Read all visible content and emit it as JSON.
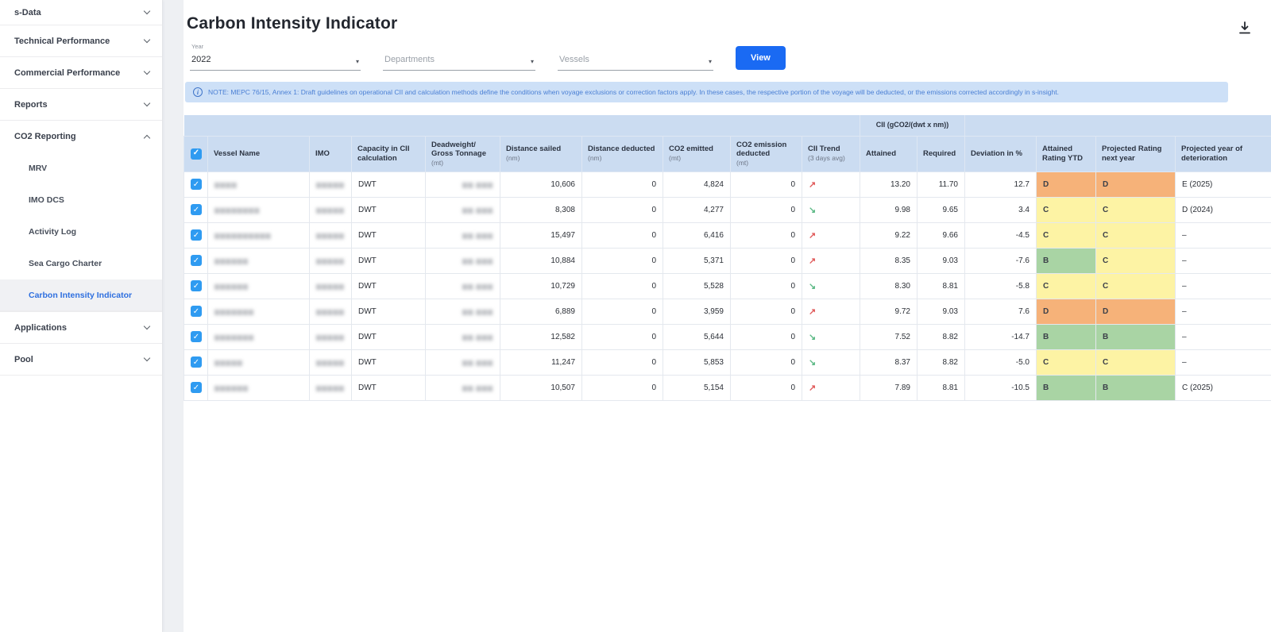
{
  "sidebar": {
    "items": [
      {
        "label": "s-Data",
        "state": "collapsed"
      },
      {
        "label": "Technical Performance",
        "state": "collapsed"
      },
      {
        "label": "Commercial Performance",
        "state": "collapsed"
      },
      {
        "label": "Reports",
        "state": "collapsed"
      },
      {
        "label": "CO2 Reporting",
        "state": "expanded"
      },
      {
        "label": "Applications",
        "state": "collapsed"
      },
      {
        "label": "Pool",
        "state": "collapsed"
      }
    ],
    "co2_children": [
      {
        "label": "MRV",
        "active": false
      },
      {
        "label": "IMO DCS",
        "active": false
      },
      {
        "label": "Activity Log",
        "active": false
      },
      {
        "label": "Sea Cargo Charter",
        "active": false
      },
      {
        "label": "Carbon Intensity Indicator",
        "active": true
      }
    ]
  },
  "header": {
    "title": "Carbon Intensity Indicator"
  },
  "filters": {
    "year_label": "Year",
    "year_value": "2022",
    "departments_placeholder": "Departments",
    "vessels_placeholder": "Vessels",
    "view_button": "View"
  },
  "note": "NOTE: MEPC 76/15, Annex 1: Draft guidelines on operational CII and calculation methods define the conditions when voyage exclusions or correction factors apply. In these cases, the respective portion of the voyage will be deducted, or the emissions corrected accordingly in s-insight.",
  "table": {
    "group_header": "CII (gCO2/(dwt x nm))",
    "columns": {
      "vessel": {
        "label": "Vessel Name",
        "unit": ""
      },
      "imo": {
        "label": "IMO",
        "unit": ""
      },
      "capacity": {
        "label": "Capacity in CII calculation",
        "unit": ""
      },
      "deadweight": {
        "label": "Deadweight/ Gross Tonnage",
        "unit": "(mt)"
      },
      "distance_sailed": {
        "label": "Distance sailed",
        "unit": "(nm)"
      },
      "distance_deducted": {
        "label": "Distance deducted",
        "unit": "(nm)"
      },
      "co2_emitted": {
        "label": "CO2 emitted",
        "unit": "(mt)"
      },
      "co2_deducted": {
        "label": "CO2 emission deducted",
        "unit": "(mt)"
      },
      "trend": {
        "label": "CII Trend",
        "unit": "(3 days avg)"
      },
      "attained": {
        "label": "Attained",
        "unit": ""
      },
      "required": {
        "label": "Required",
        "unit": ""
      },
      "deviation": {
        "label": "Deviation in %",
        "unit": ""
      },
      "attained_rating": {
        "label": "Attained Rating YTD",
        "unit": ""
      },
      "projected_rating": {
        "label": "Projected Rating next year",
        "unit": ""
      },
      "projected_year": {
        "label": "Projected year of deterioration",
        "unit": ""
      }
    },
    "rating_colors": {
      "B": "#a9d4a4",
      "C": "#fdf3a4",
      "D": "#f6b279"
    },
    "trend_glyphs": {
      "up": "↗",
      "down": "↘"
    },
    "trend_colors": {
      "up": "#e05b5b",
      "down": "#5cb985"
    },
    "rows": [
      {
        "vessel": "▆▆▆▆",
        "imo": "▆▆▆▆▆",
        "capacity": "DWT",
        "deadweight": "▆▆,▆▆▆",
        "distance_sailed": "10,606",
        "distance_deducted": "0",
        "co2_emitted": "4,824",
        "co2_deducted": "0",
        "trend": "up",
        "attained": "13.20",
        "required": "11.70",
        "deviation": "12.7",
        "attained_rating": "D",
        "projected_rating": "D",
        "projected_year": "E (2025)"
      },
      {
        "vessel": "▆▆▆▆▆▆▆▆",
        "imo": "▆▆▆▆▆",
        "capacity": "DWT",
        "deadweight": "▆▆,▆▆▆",
        "distance_sailed": "8,308",
        "distance_deducted": "0",
        "co2_emitted": "4,277",
        "co2_deducted": "0",
        "trend": "down",
        "attained": "9.98",
        "required": "9.65",
        "deviation": "3.4",
        "attained_rating": "C",
        "projected_rating": "C",
        "projected_year": "D (2024)"
      },
      {
        "vessel": "▆▆▆▆▆▆▆▆▆▆",
        "imo": "▆▆▆▆▆",
        "capacity": "DWT",
        "deadweight": "▆▆,▆▆▆",
        "distance_sailed": "15,497",
        "distance_deducted": "0",
        "co2_emitted": "6,416",
        "co2_deducted": "0",
        "trend": "up",
        "attained": "9.22",
        "required": "9.66",
        "deviation": "-4.5",
        "attained_rating": "C",
        "projected_rating": "C",
        "projected_year": "–"
      },
      {
        "vessel": "▆▆▆▆▆▆",
        "imo": "▆▆▆▆▆",
        "capacity": "DWT",
        "deadweight": "▆▆,▆▆▆",
        "distance_sailed": "10,884",
        "distance_deducted": "0",
        "co2_emitted": "5,371",
        "co2_deducted": "0",
        "trend": "up",
        "attained": "8.35",
        "required": "9.03",
        "deviation": "-7.6",
        "attained_rating": "B",
        "projected_rating": "C",
        "projected_year": "–"
      },
      {
        "vessel": "▆▆▆▆▆▆",
        "imo": "▆▆▆▆▆",
        "capacity": "DWT",
        "deadweight": "▆▆,▆▆▆",
        "distance_sailed": "10,729",
        "distance_deducted": "0",
        "co2_emitted": "5,528",
        "co2_deducted": "0",
        "trend": "down",
        "attained": "8.30",
        "required": "8.81",
        "deviation": "-5.8",
        "attained_rating": "C",
        "projected_rating": "C",
        "projected_year": "–"
      },
      {
        "vessel": "▆▆▆▆▆▆▆",
        "imo": "▆▆▆▆▆",
        "capacity": "DWT",
        "deadweight": "▆▆,▆▆▆",
        "distance_sailed": "6,889",
        "distance_deducted": "0",
        "co2_emitted": "3,959",
        "co2_deducted": "0",
        "trend": "up",
        "attained": "9.72",
        "required": "9.03",
        "deviation": "7.6",
        "attained_rating": "D",
        "projected_rating": "D",
        "projected_year": "–"
      },
      {
        "vessel": "▆▆▆▆▆▆▆",
        "imo": "▆▆▆▆▆",
        "capacity": "DWT",
        "deadweight": "▆▆,▆▆▆",
        "distance_sailed": "12,582",
        "distance_deducted": "0",
        "co2_emitted": "5,644",
        "co2_deducted": "0",
        "trend": "down",
        "attained": "7.52",
        "required": "8.82",
        "deviation": "-14.7",
        "attained_rating": "B",
        "projected_rating": "B",
        "projected_year": "–"
      },
      {
        "vessel": "▆▆▆▆▆",
        "imo": "▆▆▆▆▆",
        "capacity": "DWT",
        "deadweight": "▆▆,▆▆▆",
        "distance_sailed": "11,247",
        "distance_deducted": "0",
        "co2_emitted": "5,853",
        "co2_deducted": "0",
        "trend": "down",
        "attained": "8.37",
        "required": "8.82",
        "deviation": "-5.0",
        "attained_rating": "C",
        "projected_rating": "C",
        "projected_year": "–"
      },
      {
        "vessel": "▆▆▆▆▆▆",
        "imo": "▆▆▆▆▆",
        "capacity": "DWT",
        "deadweight": "▆▆,▆▆▆",
        "distance_sailed": "10,507",
        "distance_deducted": "0",
        "co2_emitted": "5,154",
        "co2_deducted": "0",
        "trend": "up",
        "attained": "7.89",
        "required": "8.81",
        "deviation": "-10.5",
        "attained_rating": "B",
        "projected_rating": "B",
        "projected_year": "C (2025)"
      }
    ]
  },
  "colors": {
    "accent_blue": "#1a6af3",
    "header_blue": "#cbdcf1",
    "note_bg": "#cde0f7",
    "note_text": "#4a7fd4",
    "checkbox_blue": "#2f9bf1",
    "active_link": "#2e6fdf"
  }
}
